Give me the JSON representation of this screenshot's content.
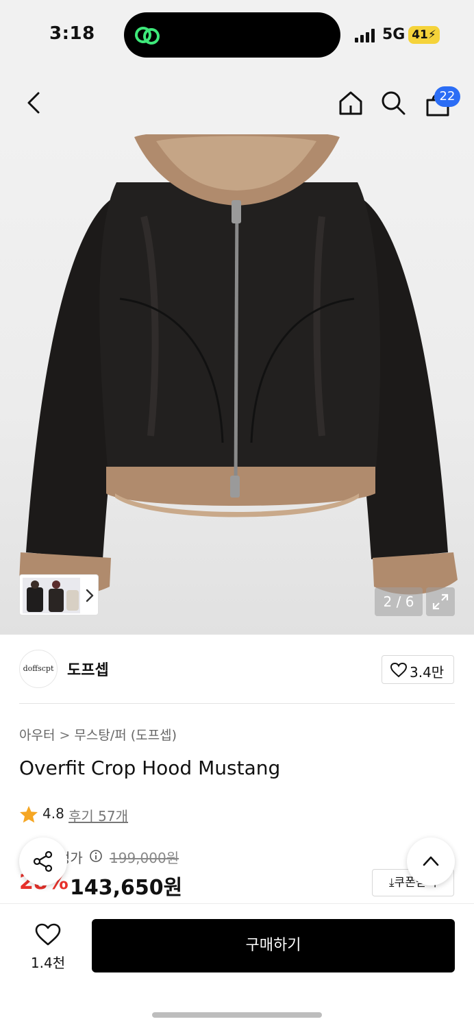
{
  "status_bar": {
    "time": "3:18",
    "network": "5G",
    "battery": "41",
    "icons": [
      "signal-icon",
      "link-app-icon",
      "battery-charging-icon"
    ]
  },
  "header": {
    "cart_count": "22",
    "icons": [
      "back-icon",
      "home-icon",
      "search-icon",
      "shopping-bag-icon"
    ]
  },
  "gallery": {
    "pager": "2 / 6",
    "icons": [
      "expand-icon",
      "chevron-right-icon"
    ]
  },
  "brand": {
    "logo_text": "doffscpt",
    "name": "도프셉",
    "likes": "3.4만"
  },
  "category": {
    "level1": "아우터",
    "level2": "무스탕/퍼 (도프셉)",
    "separator": ">"
  },
  "product": {
    "title": "Overfit Crop Hood Mustang",
    "rating": "4.8",
    "reviews": "후기 57개"
  },
  "price": {
    "label": "정가",
    "original": "199,000원",
    "discount": "28%",
    "sale": "143,650원",
    "coupon": "쿠폰받기"
  },
  "bottom_bar": {
    "wish_count": "1.4천",
    "buy_label": "구매하기"
  },
  "colors": {
    "accent_blue": "#2b6df5",
    "discount_red": "#e8322c",
    "buy_button": "#000000",
    "star": "#f5a623"
  }
}
